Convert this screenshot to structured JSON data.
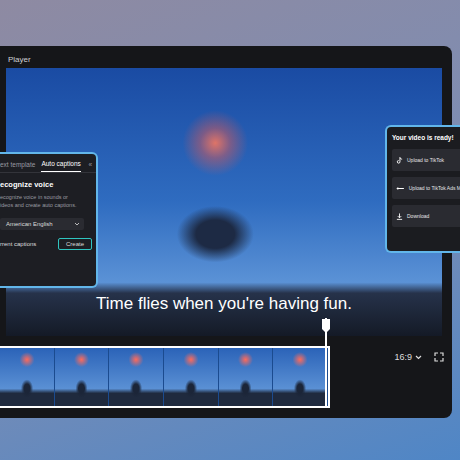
{
  "window": {
    "title": "Player"
  },
  "video": {
    "caption": "Time flies when you're having fun."
  },
  "caption_panel": {
    "tabs": [
      {
        "label": "ext template",
        "selected": false
      },
      {
        "label": "Auto captions",
        "selected": true
      }
    ],
    "collapse_icon": "«",
    "heading": "ecognize voice",
    "description": [
      "ecognize voice in sounds or",
      "ideos and create auto captions."
    ],
    "language": "American English",
    "footer_label": "rrent captions",
    "create_button": "Create"
  },
  "export_panel": {
    "title": "Your video is ready!",
    "actions": [
      {
        "label": "Upload to TikTok",
        "kind": "tiktok"
      },
      {
        "label": "Upload to TikTok Ads M",
        "kind": "tiktok-ads"
      },
      {
        "label": "Download",
        "kind": "download"
      }
    ]
  },
  "controls": {
    "aspect_ratio": "16:9"
  },
  "timeline": {
    "playhead": {
      "level": 0.99
    }
  }
}
